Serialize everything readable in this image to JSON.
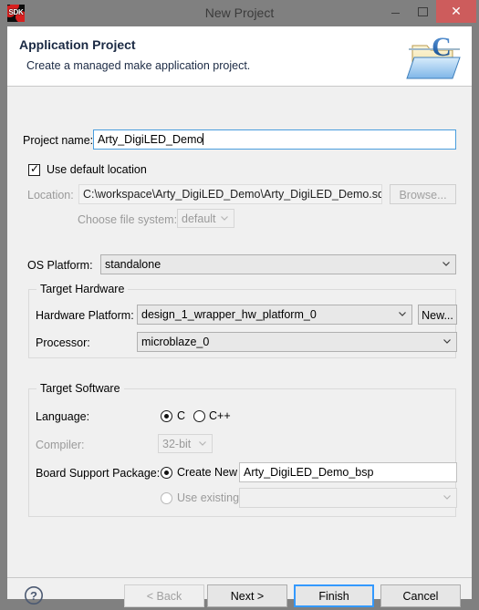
{
  "window": {
    "title": "New Project",
    "app_icon": "sdk-icon",
    "app_icon_text": "SDK",
    "controls": {
      "minimize": "minimize-icon",
      "maximize": "maximize-icon",
      "close": "✕"
    }
  },
  "header": {
    "title": "Application Project",
    "subtitle": "Create a managed make application project.",
    "icon": "c-project-folder-icon"
  },
  "form": {
    "project_name_label": "Project name:",
    "project_name_value": "Arty_DigiLED_Demo",
    "use_default_location_label": "Use default location",
    "use_default_location_checked": true,
    "location_label": "Location:",
    "location_value": "C:\\workspace\\Arty_DigiLED_Demo\\Arty_DigiLED_Demo.sdk\\",
    "browse_label": "Browse...",
    "choose_file_system_label": "Choose file system:",
    "choose_file_system_value": "default",
    "os_platform_label": "OS Platform:",
    "os_platform_value": "standalone"
  },
  "target_hardware": {
    "group_title": "Target Hardware",
    "hardware_platform_label": "Hardware Platform:",
    "hardware_platform_value": "design_1_wrapper_hw_platform_0",
    "new_label": "New...",
    "processor_label": "Processor:",
    "processor_value": "microblaze_0"
  },
  "target_software": {
    "group_title": "Target Software",
    "language_label": "Language:",
    "language_c": "C",
    "language_cpp": "C++",
    "language_selected": "C",
    "compiler_label": "Compiler:",
    "compiler_value": "32-bit",
    "bsp_label": "Board Support Package:",
    "bsp_create_new_label": "Create New",
    "bsp_create_new_value": "Arty_DigiLED_Demo_bsp",
    "bsp_use_existing_label": "Use existing",
    "bsp_use_existing_value": "",
    "bsp_selected": "Create New"
  },
  "footer": {
    "help_icon": "help-question-icon",
    "back_label": "< Back",
    "next_label": "Next >",
    "finish_label": "Finish",
    "cancel_label": "Cancel"
  },
  "colors": {
    "window_chrome": "#808080",
    "dialog_bg": "#f0f0f0",
    "header_bg": "#ffffff",
    "header_title": "#1b2a44",
    "close_button": "#cd5c5c",
    "focus_border": "#4a9ede",
    "default_button_border": "#3399ff"
  }
}
